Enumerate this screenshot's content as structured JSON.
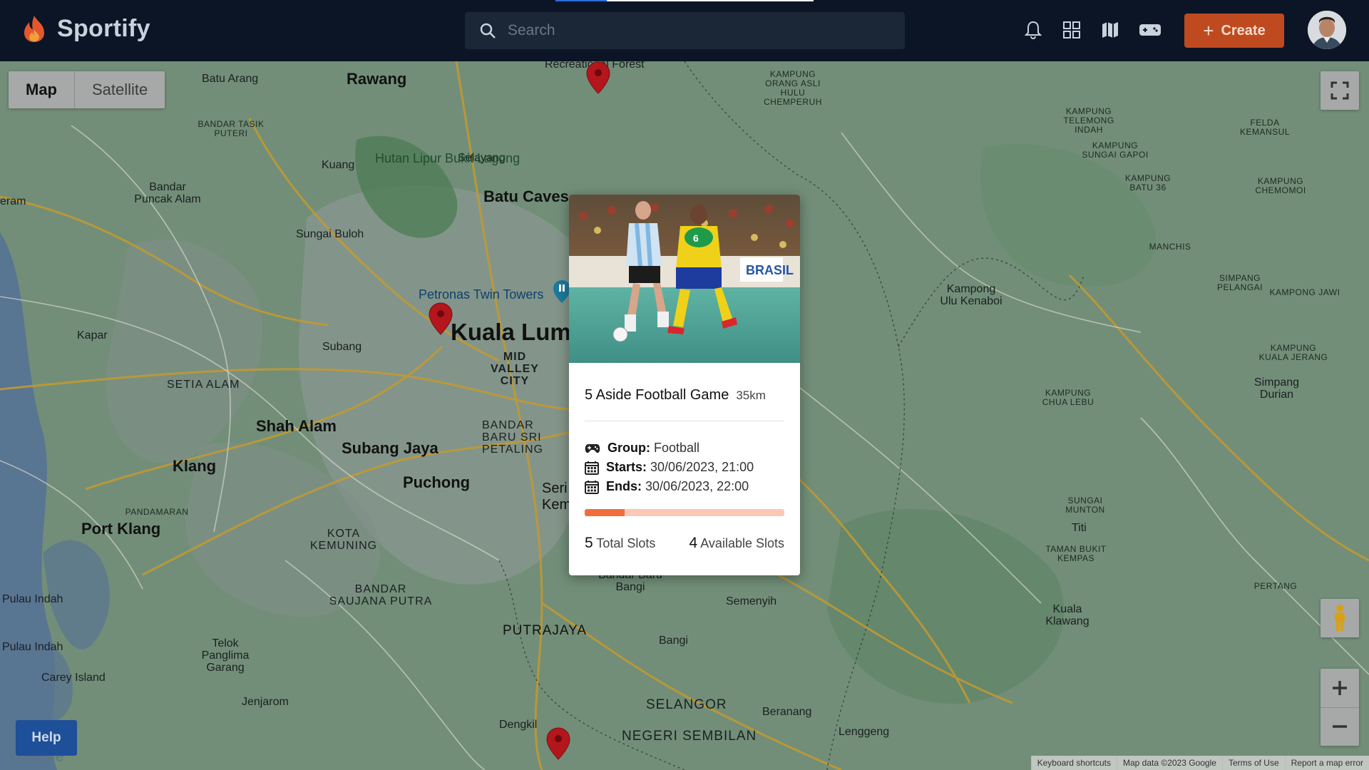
{
  "app": {
    "name": "Sportify"
  },
  "search": {
    "placeholder": "Search"
  },
  "header": {
    "icons": [
      "bell-icon",
      "grid-icon",
      "map-icon",
      "gamepad-icon"
    ],
    "create_label": "Create"
  },
  "map": {
    "type_controls": {
      "map": "Map",
      "satellite": "Satellite",
      "selected": "Map"
    },
    "labels": {
      "kl": "Kuala Lum",
      "rawang": "Rawang",
      "batu_arang": "Batu Arang",
      "batu_caves": "Batu Caves",
      "shah_alam": "Shah Alam",
      "subang_jaya": "Subang Jaya",
      "klang": "Klang",
      "puchong": "Puchong",
      "port_klang": "Port Klang",
      "setia_alam": "SETIA ALAM",
      "sungai_buloh": "Sungai Buloh",
      "kuang": "Kuang",
      "selayang": "Selayang",
      "hutan": "Hutan Lipur Bukit Lagong",
      "petronas": "Petronas Twin Towers",
      "mid_valley": "MID VALLEY CITY",
      "subang": "Subang",
      "kapar": "Kapar",
      "putrajaya": "PUTRAJAYA",
      "putrajaya2": "PUTRAJAYA",
      "bangi": "Bangi",
      "semenyih": "Semenyih",
      "selangor": "SELANGOR",
      "negeri": "NEGERI SEMBILAN",
      "dengkil": "Dengkil",
      "beranang": "Beranang",
      "lenggeng": "Lenggeng",
      "jenjarom": "Jenjarom",
      "carey": "Carey Island",
      "telok": "Telok Panglima Garang",
      "kota_kemuning": "KOTA KEMUNING",
      "bandar_saujana": "BANDAR SAUJANA PUTRA",
      "pulau_indah1": "Pulau Indah",
      "pulau_indah2": "Pulau Indah",
      "kampong_ulu": "Kampong Ulu Kenaboi",
      "titi": "Titi",
      "kuala_klawang": "Kuala Klawang",
      "simpang_durian": "Simpang Durian",
      "sungai_munton": "SUNGAI MUNTON",
      "bandar_puncak": "Bandar Puncak Alam",
      "manchis": "MANCHIS",
      "kampung_chua_lebu": "KAMPUNG CHUA LEBU",
      "pertang": "PERTANG",
      "taman_bukit": "TAMAN BUKIT KEMPAS",
      "bandar_baru_bangi": "Bandar Baru Bangi",
      "pandamaran": "PANDAMARAN",
      "bandar_tasik": "BANDAR TASIK PUTERI",
      "kampung_orang": "KAMPUNG ORANG ASLI HULU CHEMPERUH",
      "kampung_telemong": "KAMPUNG TELEMONG INDAH",
      "kampung_sungai_gapoi": "KAMPUNG SUNGAI GAPOI",
      "kampung_batu36": "KAMPUNG BATU 36",
      "kampung_chemomoi": "KAMPUNG CHEMOMOI",
      "felda_kemansul": "FELDA KEMANSUL",
      "simpang_pelangai": "SIMPANG PELANGAI",
      "kampong_jawi": "KAMPONG JAWI",
      "kampung_kuala_jerang": "KAMPUNG KUALA JERANG",
      "eram": "eram",
      "bandar_sri": "BANDAR BARU SRI PETALING",
      "seri_kembangan": "Seri Kembangan",
      "recreational": "Recreational Forest"
    },
    "attribution": [
      "Keyboard shortcuts",
      "Map data ©2023 Google",
      "Terms of Use",
      "Report a map error"
    ],
    "help_label": "Help",
    "google": "Google"
  },
  "event_card": {
    "title": "5 Aside Football Game",
    "distance": "35km",
    "group_label": "Group:",
    "group": "Football",
    "starts_label": "Starts:",
    "starts": "30/06/2023, 21:00",
    "ends_label": "Ends:",
    "ends": "30/06/2023, 22:00",
    "total_slots": "5",
    "total_slots_label": "Total Slots",
    "available_slots": "4",
    "available_slots_label": "Available Slots",
    "filled_fraction": 0.2
  },
  "colors": {
    "accent": "#f26d3c",
    "create_button": "#bf4a1f",
    "header_bg": "#0b1526",
    "pin": "#b3161c"
  }
}
